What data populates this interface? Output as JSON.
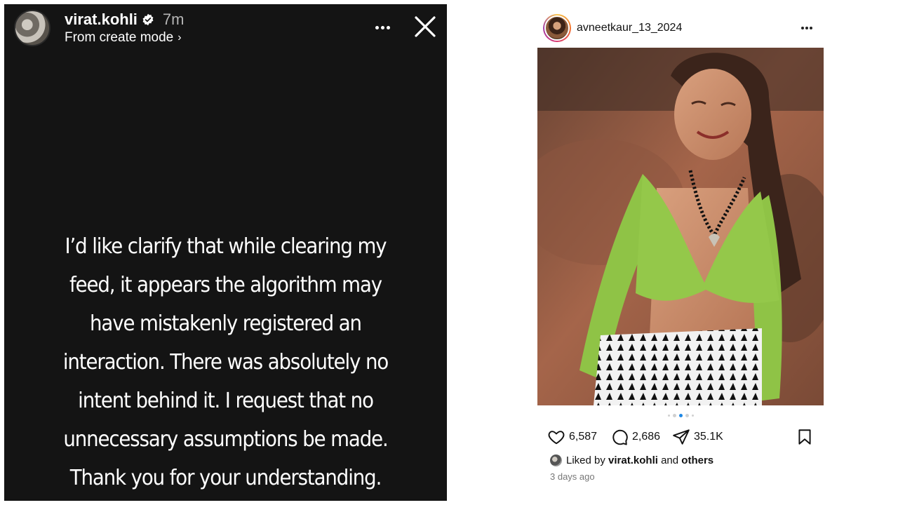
{
  "story": {
    "username": "virat.kohli",
    "time": "7m",
    "subtitle": "From create mode",
    "lines": [
      "I’d like clarify that while clearing my",
      "feed, it appears the algorithm may",
      "have mistakenly registered an",
      "interaction. There was absolutely no",
      "intent behind it. I request that no",
      "unnecessary assumptions be made.",
      "Thank you for your understanding."
    ],
    "icons": {
      "verified": "verified-badge-icon",
      "more": "more-options-icon",
      "close": "close-icon",
      "chevron": "chevron-right-icon"
    },
    "colors": {
      "background": "#141414",
      "text": "#ffffff"
    }
  },
  "post": {
    "username": "avneetkaur_13_2024",
    "likes": "6,587",
    "comments": "2,686",
    "shares": "35.1K",
    "liked_by_prefix": "Liked by",
    "liked_by_user": "virat.kohli",
    "liked_by_and": "and",
    "liked_by_others": "others",
    "date": "3 days ago",
    "carousel": {
      "count": 5,
      "active_index": 2
    },
    "icons": {
      "like": "heart-icon",
      "comment": "comment-icon",
      "share": "send-icon",
      "save": "bookmark-icon",
      "more": "more-options-icon"
    },
    "colors": {
      "carousel_active": "#1e88e5",
      "secondary_text": "#777777"
    }
  }
}
